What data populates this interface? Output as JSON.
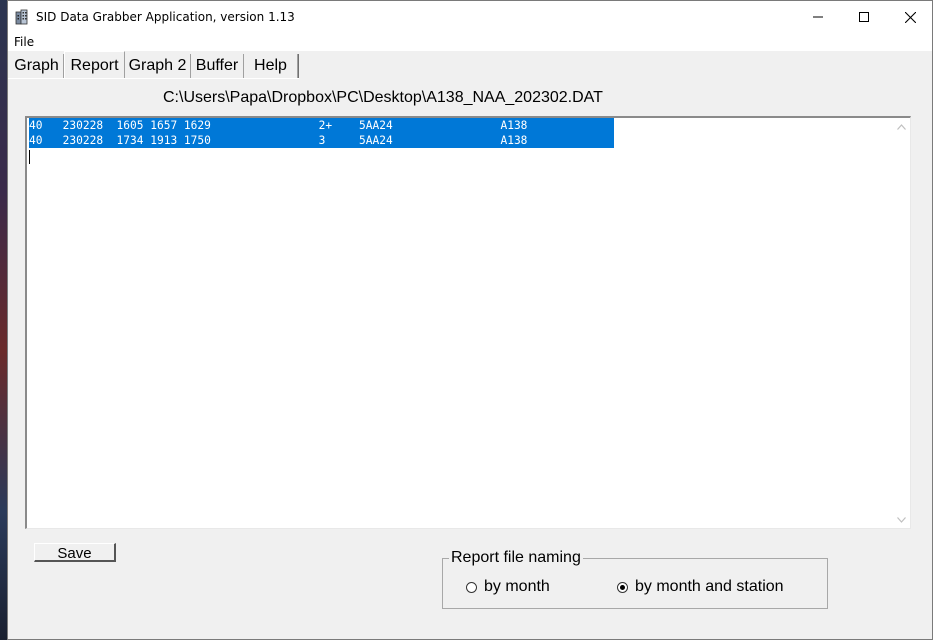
{
  "window": {
    "title": "SID Data Grabber Application, version 1.13",
    "minimize_glyph": "—",
    "maximize_glyph": "☐",
    "close_glyph": "✕"
  },
  "menu": {
    "file": "File"
  },
  "tabs": [
    {
      "label": "Graph",
      "active": false
    },
    {
      "label": "Report",
      "active": true
    },
    {
      "label": "Graph 2",
      "active": false
    },
    {
      "label": "Buffer",
      "active": false
    },
    {
      "label": "Help",
      "active": false
    }
  ],
  "report": {
    "file_path": "C:\\Users\\Papa\\Dropbox\\PC\\Desktop\\A138_NAA_202302.DAT",
    "lines": [
      "40   230228  1605 1657 1629                2+    5AA24                A138",
      "40   230228  1734 1913 1750                3     5AA24                A138"
    ]
  },
  "save_label": "Save",
  "naming": {
    "legend": "Report file naming",
    "options": [
      {
        "label": "by month",
        "selected": false
      },
      {
        "label": "by month and station",
        "selected": true
      }
    ]
  },
  "colors": {
    "selection": "#0078d7",
    "window_bg": "#f0f0f0"
  },
  "icons": {
    "app": "app-building-icon",
    "scroll_up": "chevron-up-icon",
    "scroll_down": "chevron-down-icon"
  }
}
